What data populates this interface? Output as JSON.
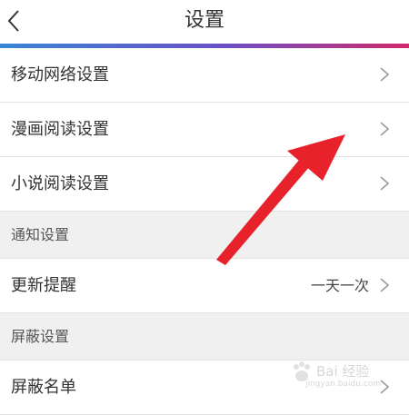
{
  "header": {
    "title": "设置",
    "back_icon": "chevron-left-icon"
  },
  "colors": {
    "accent_start": "#3a86d6",
    "accent_mid": "#6b4fc6",
    "accent_end": "#d12a6b",
    "annotation_arrow": "#e8222a"
  },
  "settings": {
    "mobile_network": "移动网络设置",
    "comic_reading": "漫画阅读设置",
    "novel_reading": "小说阅读设置",
    "notifications_section": "通知设置",
    "update_reminder": "更新提醒",
    "update_reminder_value": "一天一次",
    "block_section": "屏蔽设置",
    "block_list": "屏蔽名单"
  },
  "watermark": {
    "text": "Bai 经验",
    "sub": "jingyan.baidu.com"
  }
}
